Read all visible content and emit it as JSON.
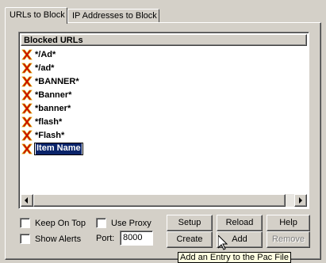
{
  "tabs": [
    {
      "label": "URLs to Block",
      "active": true
    },
    {
      "label": "IP Addresses to Block",
      "active": false
    }
  ],
  "list": {
    "header": "Blocked URLs",
    "items": [
      "*/Ad*",
      "*/ad*",
      "*BANNER*",
      "*Banner*",
      "*banner*",
      "*flash*",
      "*Flash*"
    ],
    "editing_item": "Item Name",
    "row_icon": "red-x-icon"
  },
  "options": {
    "keep_on_top": {
      "label": "Keep On Top",
      "checked": false
    },
    "use_proxy": {
      "label": "Use Proxy",
      "checked": false
    },
    "show_alerts": {
      "label": "Show Alerts",
      "checked": false
    },
    "port_label": "Port:",
    "port_value": "8000"
  },
  "buttons": {
    "setup": "Setup",
    "reload": "Reload",
    "help": "Help",
    "create": "Create",
    "add": "Add",
    "remove": "Remove"
  },
  "tooltip": "Add an Entry to the Pac File",
  "colors": {
    "face": "#d4d0c8",
    "selection": "#0a246a",
    "icon_red": "#cc0000",
    "icon_gold": "#d8a000",
    "tooltip_bg": "#ffffe1"
  }
}
